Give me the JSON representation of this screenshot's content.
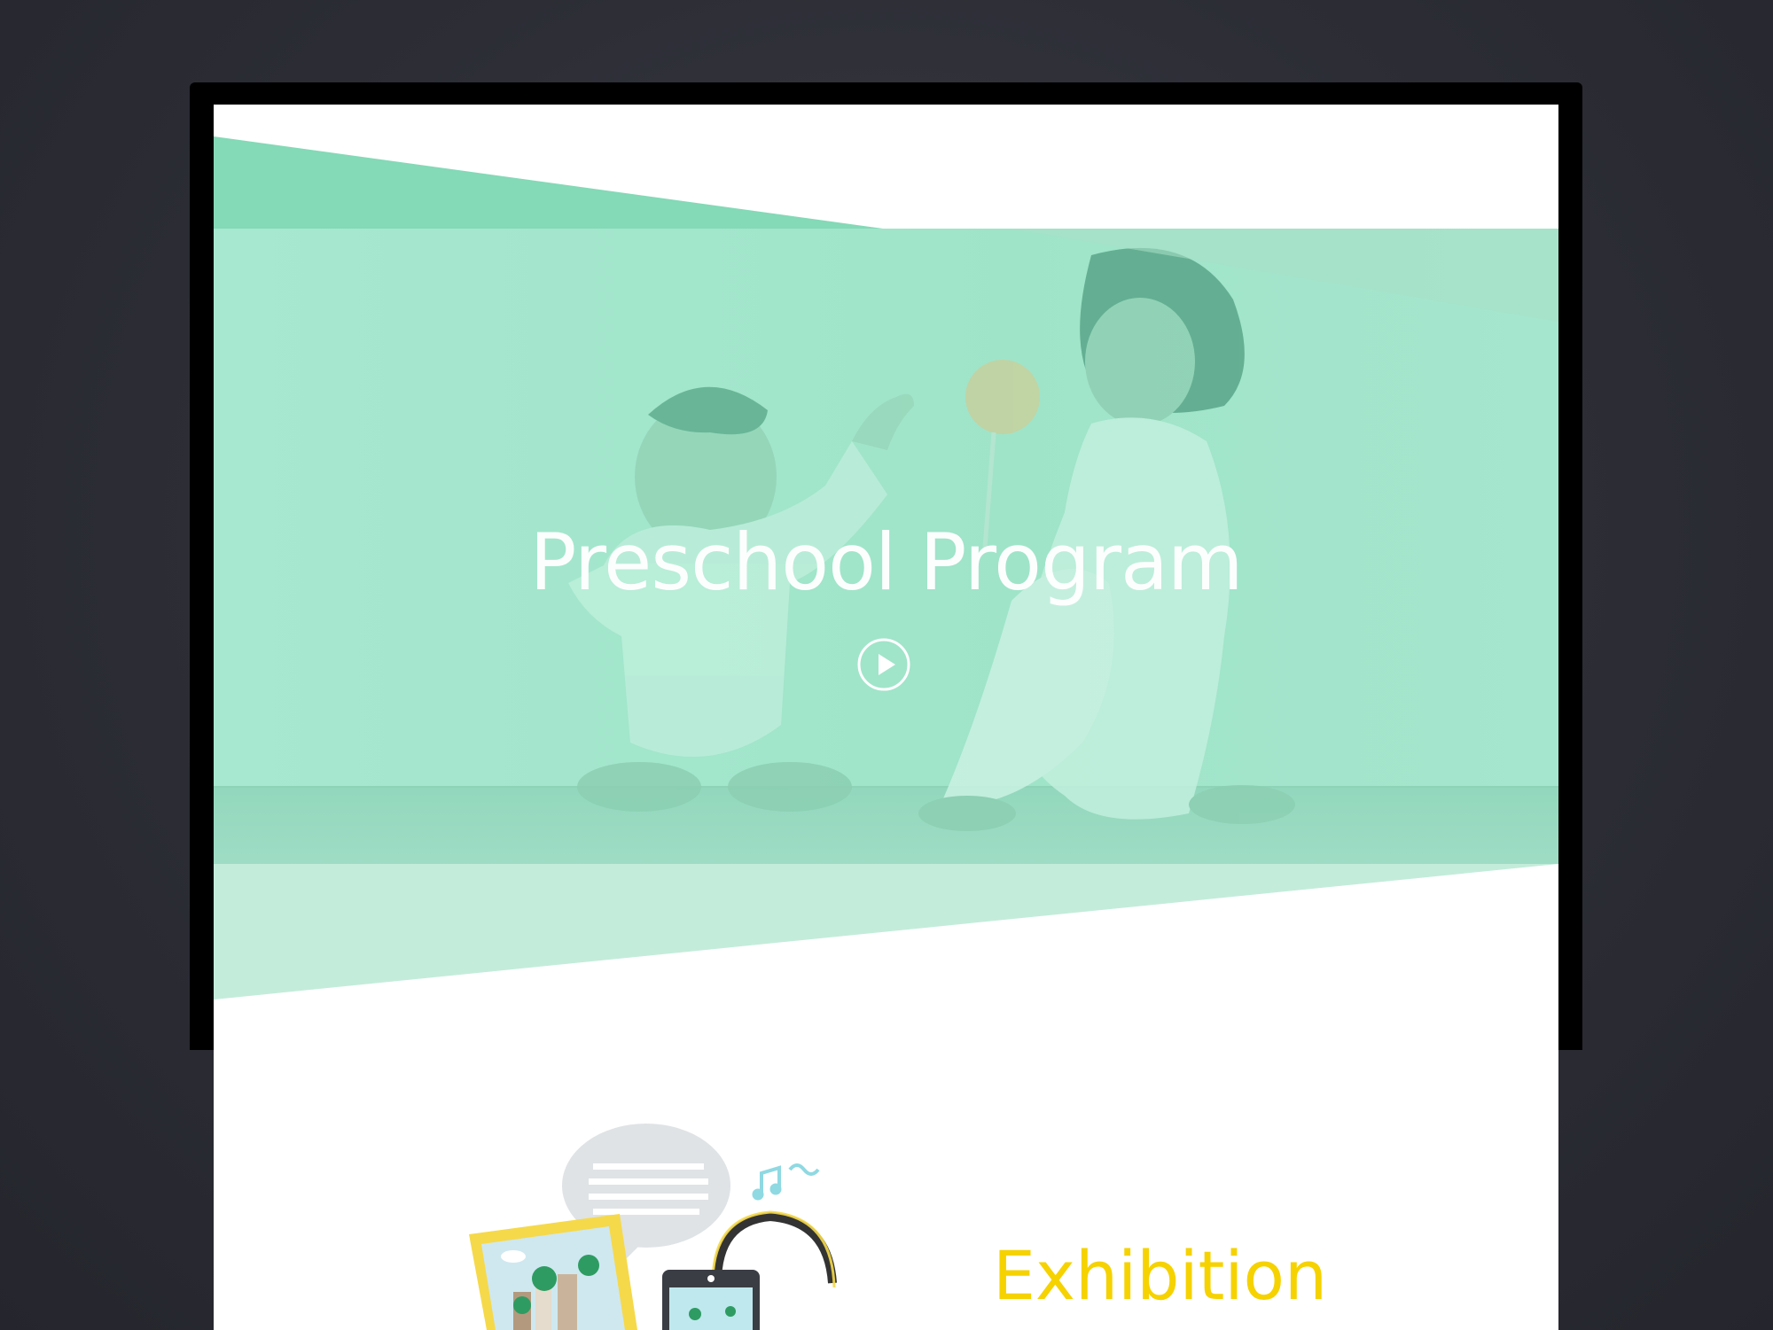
{
  "hero": {
    "title": "Preschool Program",
    "play_icon": "play-circle-icon",
    "overlay_color": "#8fe3c6",
    "band_color": "#7dd6b4"
  },
  "section": {
    "title": "Exhibition",
    "title_color": "#f5d200",
    "illustration_icons": [
      "speech-bubble-icon",
      "photo-frame-icon",
      "music-notes-icon",
      "tablet-icon",
      "headphones-icon"
    ]
  }
}
